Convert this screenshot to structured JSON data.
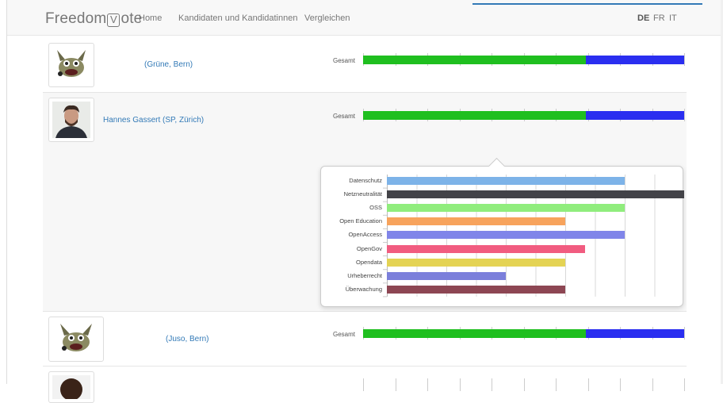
{
  "brand": {
    "name_left": "Freedom",
    "name_mark": "V",
    "name_right": "ote"
  },
  "nav": {
    "home": "Home",
    "candidates": "Kandidaten und Kandidatinnen",
    "compare": "Vergleichen"
  },
  "languages": [
    {
      "code": "DE",
      "active": true
    },
    {
      "code": "FR",
      "active": false
    },
    {
      "code": "IT",
      "active": false
    }
  ],
  "candidates": [
    {
      "name": "(Grüne, Bern)",
      "avatar": "gimp-mascot-icon",
      "overall_label": "Gesamt",
      "overall_split": 0.695
    },
    {
      "name": "Hannes Gassert (SP, Zürich)",
      "avatar": "portrait-photo",
      "overall_label": "Gesamt",
      "overall_split": 0.695
    },
    {
      "name": "(Juso, Bern)",
      "avatar": "gimp-mascot-icon",
      "overall_label": "Gesamt",
      "overall_split": 0.695
    },
    {
      "name": "",
      "avatar": "portrait-photo",
      "overall_label": "",
      "overall_split": null
    }
  ],
  "colors": {
    "overall_green": "#1fbf1f",
    "overall_blue": "#2a2ef0",
    "link": "#337ab7"
  },
  "chart_data": {
    "type": "bar",
    "orientation": "horizontal",
    "categories": [
      "Datenschutz",
      "Netzneutralität",
      "OSS",
      "Open Education",
      "OpenAccess",
      "OpenGov",
      "Opendata",
      "Urheberrecht",
      "Überwachung"
    ],
    "values": [
      8,
      10,
      8,
      6,
      8,
      6.67,
      6,
      4,
      6
    ],
    "colors": [
      "#7db3e8",
      "#434348",
      "#90ed7d",
      "#f7a35c",
      "#8085e9",
      "#f15c80",
      "#e4d354",
      "#7b7fdb",
      "#8d4653"
    ],
    "xlim": [
      0,
      10
    ],
    "grid": true,
    "title": "",
    "xlabel": "",
    "ylabel": ""
  }
}
